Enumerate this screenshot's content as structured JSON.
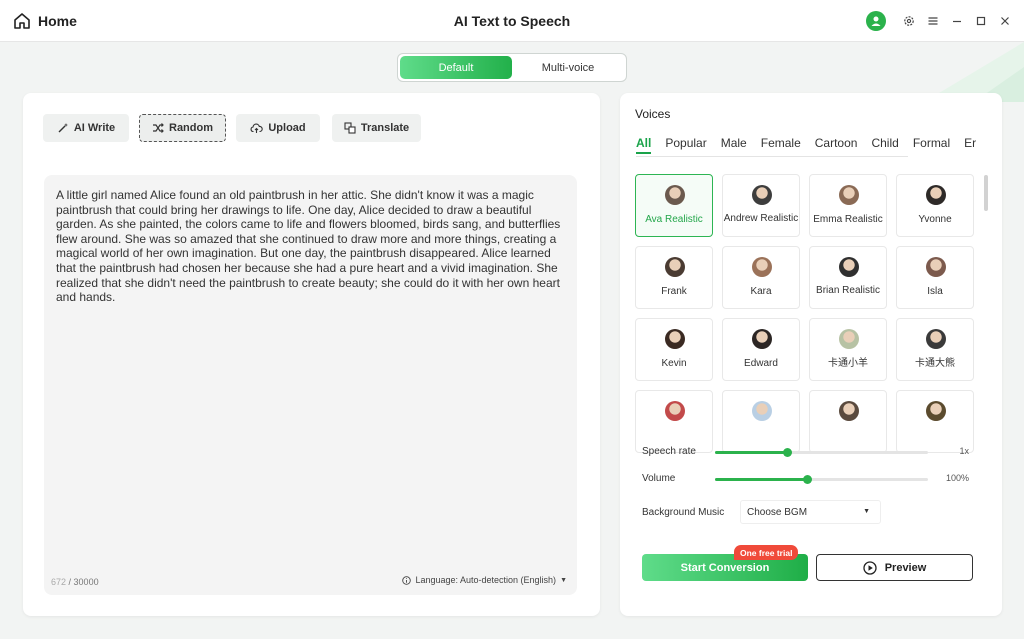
{
  "header": {
    "home_label": "Home",
    "app_title": "AI Text to Speech"
  },
  "mode": {
    "default_label": "Default",
    "multivoice_label": "Multi-voice",
    "selected": "Default"
  },
  "toolbar": {
    "ai_write": "AI Write",
    "random": "Random",
    "upload": "Upload",
    "translate": "Translate"
  },
  "editor": {
    "text": "A little girl named Alice found an old paintbrush in her attic. She didn't know it was a magic paintbrush that could bring her drawings to life.  One day, Alice decided to draw a beautiful garden. As she painted, the colors came to life and flowers bloomed, birds sang, and butterflies flew around. She was so amazed that she continued to draw more and more things, creating a magical world of her own imagination.  But one day, the paintbrush disappeared. Alice learned that the paintbrush had chosen her because she had a pure heart and a vivid imagination. She realized that she didn't need the paintbrush to create beauty; she could do it with her own heart and hands.",
    "char_current": "672",
    "char_sep": " / ",
    "char_max": "30000",
    "language": "Language: Auto-detection (English)"
  },
  "voices": {
    "title": "Voices",
    "tabs": [
      "All",
      "Popular",
      "Male",
      "Female",
      "Cartoon",
      "Child",
      "Formal",
      "Er"
    ],
    "selected_tab": "All",
    "items": [
      {
        "name": "Ava Realistic",
        "selected": true,
        "color": "#6b5a4e"
      },
      {
        "name": "Andrew Realistic",
        "selected": false,
        "color": "#3d3d3d"
      },
      {
        "name": "Emma Realistic",
        "selected": false,
        "color": "#8a6a55"
      },
      {
        "name": "Yvonne",
        "selected": false,
        "color": "#2e2a28"
      },
      {
        "name": "Frank",
        "selected": false,
        "color": "#4a3b32"
      },
      {
        "name": "Kara",
        "selected": false,
        "color": "#9b7259"
      },
      {
        "name": "Brian Realistic",
        "selected": false,
        "color": "#2f2f2f"
      },
      {
        "name": "Isla",
        "selected": false,
        "color": "#7c5a4d"
      },
      {
        "name": "Kevin",
        "selected": false,
        "color": "#3a2a22"
      },
      {
        "name": "Edward",
        "selected": false,
        "color": "#2c2624"
      },
      {
        "name": "卡通小羊",
        "selected": false,
        "color": "#b7c2a4"
      },
      {
        "name": "卡通大熊",
        "selected": false,
        "color": "#3a3a3a"
      },
      {
        "name": "",
        "selected": false,
        "color": "#c24a4a"
      },
      {
        "name": "",
        "selected": false,
        "color": "#b9cfe4"
      },
      {
        "name": "",
        "selected": false,
        "color": "#5a4a3e"
      },
      {
        "name": "",
        "selected": false,
        "color": "#5b4b2e"
      }
    ]
  },
  "speech_rate": {
    "label": "Speech rate",
    "value": "1x",
    "fraction": 0.34
  },
  "volume": {
    "label": "Volume",
    "value": "100%",
    "fraction": 0.43
  },
  "bgm": {
    "label": "Background Music",
    "value": "Choose BGM"
  },
  "actions": {
    "start_label": "Start Conversion",
    "trial_badge": "One free trial",
    "preview_label": "Preview"
  },
  "colors": {
    "accent": "#2bb24c",
    "badge": "#f04a3a"
  }
}
